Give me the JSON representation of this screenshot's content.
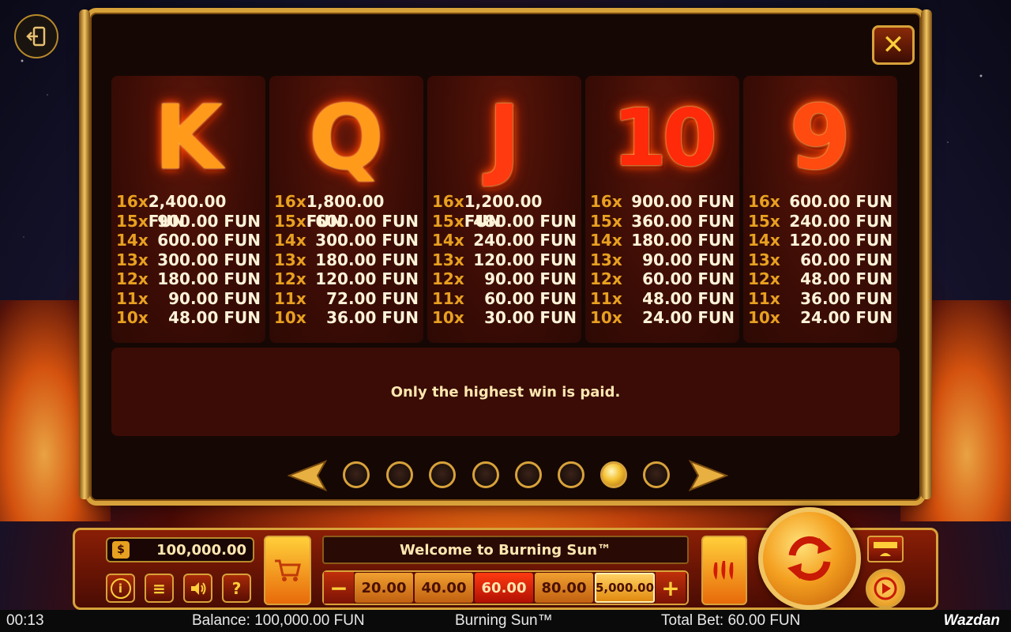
{
  "paytable": {
    "panels": [
      {
        "symbol": "K",
        "pays": [
          {
            "mult": "16x",
            "amount": "2,400.00 FUN"
          },
          {
            "mult": "15x",
            "amount": "900.00 FUN"
          },
          {
            "mult": "14x",
            "amount": "600.00 FUN"
          },
          {
            "mult": "13x",
            "amount": "300.00 FUN"
          },
          {
            "mult": "12x",
            "amount": "180.00 FUN"
          },
          {
            "mult": "11x",
            "amount": "90.00 FUN"
          },
          {
            "mult": "10x",
            "amount": "48.00 FUN"
          }
        ]
      },
      {
        "symbol": "Q",
        "pays": [
          {
            "mult": "16x",
            "amount": "1,800.00 FUN"
          },
          {
            "mult": "15x",
            "amount": "600.00 FUN"
          },
          {
            "mult": "14x",
            "amount": "300.00 FUN"
          },
          {
            "mult": "13x",
            "amount": "180.00 FUN"
          },
          {
            "mult": "12x",
            "amount": "120.00 FUN"
          },
          {
            "mult": "11x",
            "amount": "72.00 FUN"
          },
          {
            "mult": "10x",
            "amount": "36.00 FUN"
          }
        ]
      },
      {
        "symbol": "J",
        "pays": [
          {
            "mult": "16x",
            "amount": "1,200.00 FUN"
          },
          {
            "mult": "15x",
            "amount": "480.00 FUN"
          },
          {
            "mult": "14x",
            "amount": "240.00 FUN"
          },
          {
            "mult": "13x",
            "amount": "120.00 FUN"
          },
          {
            "mult": "12x",
            "amount": "90.00 FUN"
          },
          {
            "mult": "11x",
            "amount": "60.00 FUN"
          },
          {
            "mult": "10x",
            "amount": "30.00 FUN"
          }
        ]
      },
      {
        "symbol": "10",
        "pays": [
          {
            "mult": "16x",
            "amount": "900.00 FUN"
          },
          {
            "mult": "15x",
            "amount": "360.00 FUN"
          },
          {
            "mult": "14x",
            "amount": "180.00 FUN"
          },
          {
            "mult": "13x",
            "amount": "90.00 FUN"
          },
          {
            "mult": "12x",
            "amount": "60.00 FUN"
          },
          {
            "mult": "11x",
            "amount": "48.00 FUN"
          },
          {
            "mult": "10x",
            "amount": "24.00 FUN"
          }
        ]
      },
      {
        "symbol": "9",
        "pays": [
          {
            "mult": "16x",
            "amount": "600.00 FUN"
          },
          {
            "mult": "15x",
            "amount": "240.00 FUN"
          },
          {
            "mult": "14x",
            "amount": "120.00 FUN"
          },
          {
            "mult": "13x",
            "amount": "60.00 FUN"
          },
          {
            "mult": "12x",
            "amount": "48.00 FUN"
          },
          {
            "mult": "11x",
            "amount": "36.00 FUN"
          },
          {
            "mult": "10x",
            "amount": "24.00 FUN"
          }
        ]
      }
    ],
    "note": "Only the highest win is paid.",
    "close_label": "✕",
    "pages": {
      "total": 8,
      "active": 7
    }
  },
  "controls": {
    "balance": "100,000.00",
    "message": "Welcome to Burning Sun™",
    "bet_options": [
      "20.00",
      "40.00",
      "60.00",
      "80.00",
      "5,000.00"
    ],
    "selected_bet": "60.00",
    "minus": "−",
    "plus": "+",
    "info": "i",
    "menu": "≡",
    "help": "?",
    "bag_glyph": "$"
  },
  "status_bar": {
    "time": "00:13",
    "balance": "Balance: 100,000.00 FUN",
    "game_title": "Burning Sun™",
    "total_bet": "Total Bet: 60.00 FUN",
    "brand": "Wazdan"
  },
  "colors": {
    "gold": "#d8a23a",
    "panel_bg": "#3a0c05",
    "multiplier": "#e8a020",
    "amount": "#fff3d8"
  },
  "icons": [
    "exit-icon",
    "close-icon",
    "cart-icon",
    "info-icon",
    "menu-icon",
    "sound-icon",
    "help-icon",
    "pepper-icon",
    "spin-icon",
    "turbo-icon",
    "autoplay-icon",
    "left-arrow-icon",
    "right-arrow-icon"
  ]
}
